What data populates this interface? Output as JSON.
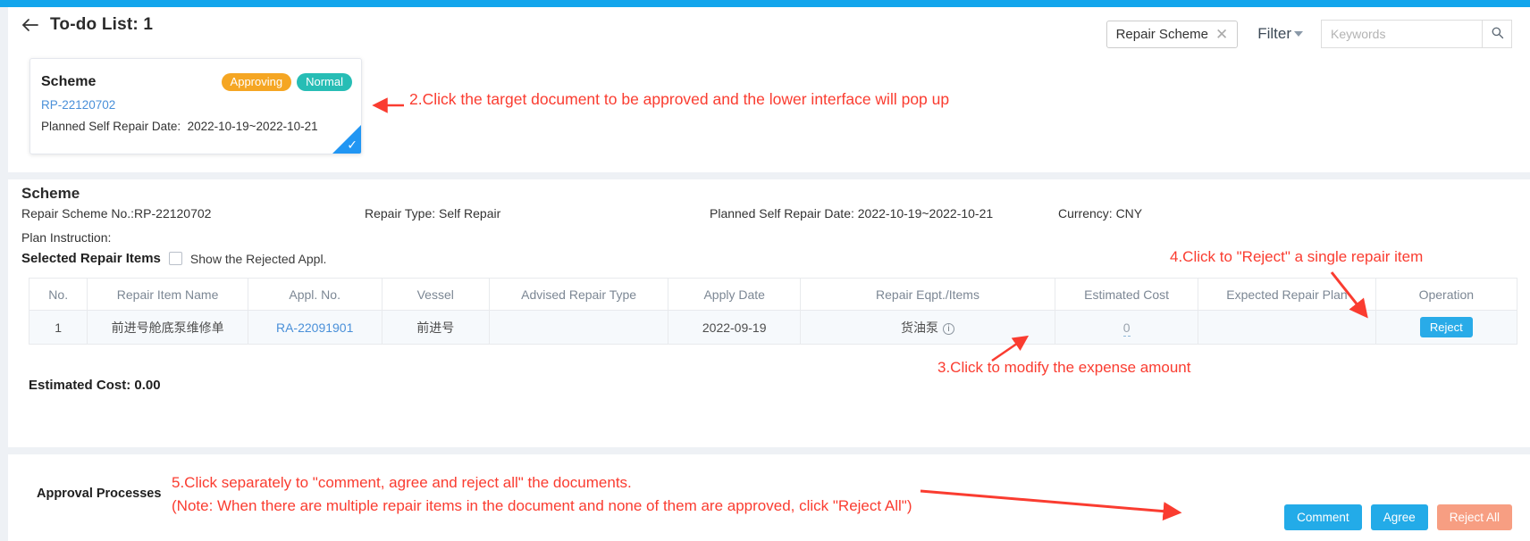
{
  "header": {
    "back_icon": "back-arrow-icon",
    "title": "To-do List: 1",
    "tag_label": "Repair Scheme",
    "tag_close_icon": "close-icon",
    "filter_label": "Filter",
    "filter_caret_icon": "chevron-down-icon",
    "search_placeholder": "Keywords",
    "search_value": "",
    "search_icon": "search-icon"
  },
  "todo_card": {
    "title": "Scheme",
    "badge_status": "Approving",
    "badge_priority": "Normal",
    "doc_no": "RP-22120702",
    "date_label": "Planned Self Repair Date:",
    "date_value": "2022-10-19~2022-10-21",
    "selected_check_icon": "check-icon",
    "badge_status_color": "#f5a623",
    "badge_priority_color": "#27bdb5"
  },
  "scheme": {
    "section_title": "Scheme",
    "meta": {
      "repair_scheme_no": "Repair Scheme No.:RP-22120702",
      "repair_type": "Repair Type: Self Repair",
      "planned_self_repair_date": "Planned Self Repair Date: 2022-10-19~2022-10-21",
      "currency": "Currency: CNY"
    },
    "plan_instruction": "Plan Instruction:",
    "selected_items_title": "Selected Repair Items",
    "show_rejected_label": "Show the Rejected Appl.",
    "show_rejected_checked": false,
    "estimated_cost_total": "Estimated Cost: 0.00"
  },
  "table": {
    "columns": [
      "No.",
      "Repair Item Name",
      "Appl. No.",
      "Vessel",
      "Advised Repair Type",
      "Apply Date",
      "Repair Eqpt./Items",
      "Estimated Cost",
      "Expected Repair Plan",
      "Operation"
    ],
    "rows": [
      {
        "no": "1",
        "repair_item_name": "前进号舱底泵维修单",
        "appl_no": "RA-22091901",
        "vessel": "前进号",
        "advised_repair_type": "",
        "apply_date": "2022-09-19",
        "repair_eqpt_items": "货油泵",
        "repair_eqpt_info_icon": "info-icon",
        "estimated_cost": "0",
        "expected_repair_plan": "",
        "operation_button": "Reject"
      }
    ]
  },
  "approval": {
    "label": "Approval Processes",
    "buttons": {
      "comment": "Comment",
      "agree": "Agree",
      "reject_all": "Reject All"
    },
    "comment_color": "#23abe8",
    "agree_color": "#23abe8",
    "reject_all_color": "#f79e82"
  },
  "annotations": {
    "step2": "2.Click the target document to be approved and the lower interface will pop up",
    "step4": "4.Click to \"Reject\" a single repair item",
    "step3": "3.Click to modify the expense amount",
    "step5_line1": "5.Click separately to \"comment, agree and reject all\" the documents.",
    "step5_line2": "(Note: When there are multiple repair items in the document and none of them are approved, click \"Reject All\")",
    "color": "#fa3c30"
  }
}
